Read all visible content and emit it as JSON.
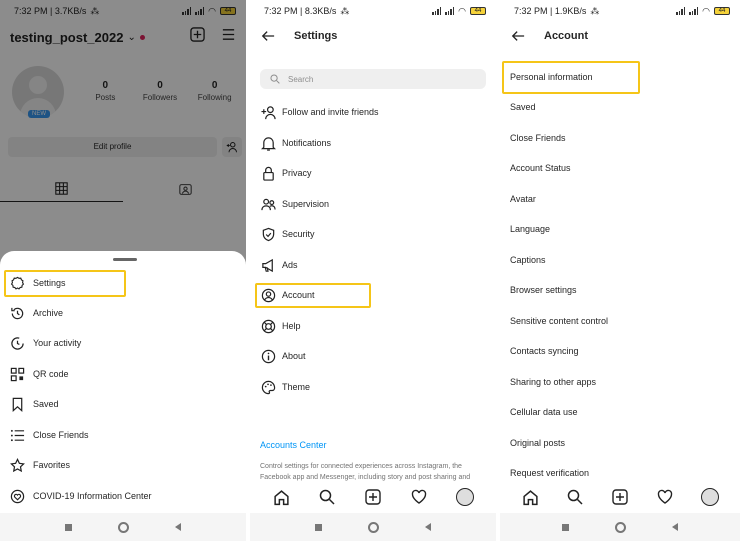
{
  "accent_color": "#f5c518",
  "link_color": "#0095f6",
  "panel1": {
    "status": {
      "time": "7:32 PM | 3.7KB/s",
      "battery": "44"
    },
    "username": "testing_post_2022",
    "new_badge": "NEW",
    "stats": [
      {
        "num": "0",
        "label": "Posts"
      },
      {
        "num": "0",
        "label": "Followers"
      },
      {
        "num": "0",
        "label": "Following"
      }
    ],
    "edit_profile": "Edit profile",
    "menu": [
      {
        "label": "Settings",
        "icon": "gear-icon"
      },
      {
        "label": "Archive",
        "icon": "archive-icon"
      },
      {
        "label": "Your activity",
        "icon": "activity-icon"
      },
      {
        "label": "QR code",
        "icon": "qr-code-icon"
      },
      {
        "label": "Saved",
        "icon": "bookmark-icon"
      },
      {
        "label": "Close Friends",
        "icon": "list-icon"
      },
      {
        "label": "Favorites",
        "icon": "star-icon"
      },
      {
        "label": "COVID-19 Information Center",
        "icon": "info-heart-icon"
      }
    ]
  },
  "panel2": {
    "status": {
      "time": "7:32 PM | 8.3KB/s",
      "battery": "44"
    },
    "title": "Settings",
    "search_placeholder": "Search",
    "items": [
      {
        "label": "Follow and invite friends",
        "icon": "add-person-icon"
      },
      {
        "label": "Notifications",
        "icon": "bell-icon"
      },
      {
        "label": "Privacy",
        "icon": "lock-icon"
      },
      {
        "label": "Supervision",
        "icon": "supervision-icon"
      },
      {
        "label": "Security",
        "icon": "shield-icon"
      },
      {
        "label": "Ads",
        "icon": "megaphone-icon"
      },
      {
        "label": "Account",
        "icon": "account-icon"
      },
      {
        "label": "Help",
        "icon": "lifebuoy-icon"
      },
      {
        "label": "About",
        "icon": "info-icon"
      },
      {
        "label": "Theme",
        "icon": "palette-icon"
      }
    ],
    "accounts_center": "Accounts Center",
    "accounts_center_desc": "Control settings for connected experiences across Instagram, the Facebook app and Messenger, including story and post sharing and"
  },
  "panel3": {
    "status": {
      "time": "7:32 PM | 1.9KB/s",
      "battery": "44"
    },
    "title": "Account",
    "items": [
      "Personal information",
      "Saved",
      "Close Friends",
      "Account Status",
      "Avatar",
      "Language",
      "Captions",
      "Browser settings",
      "Sensitive content control",
      "Contacts syncing",
      "Sharing to other apps",
      "Cellular data use",
      "Original posts",
      "Request verification"
    ]
  }
}
